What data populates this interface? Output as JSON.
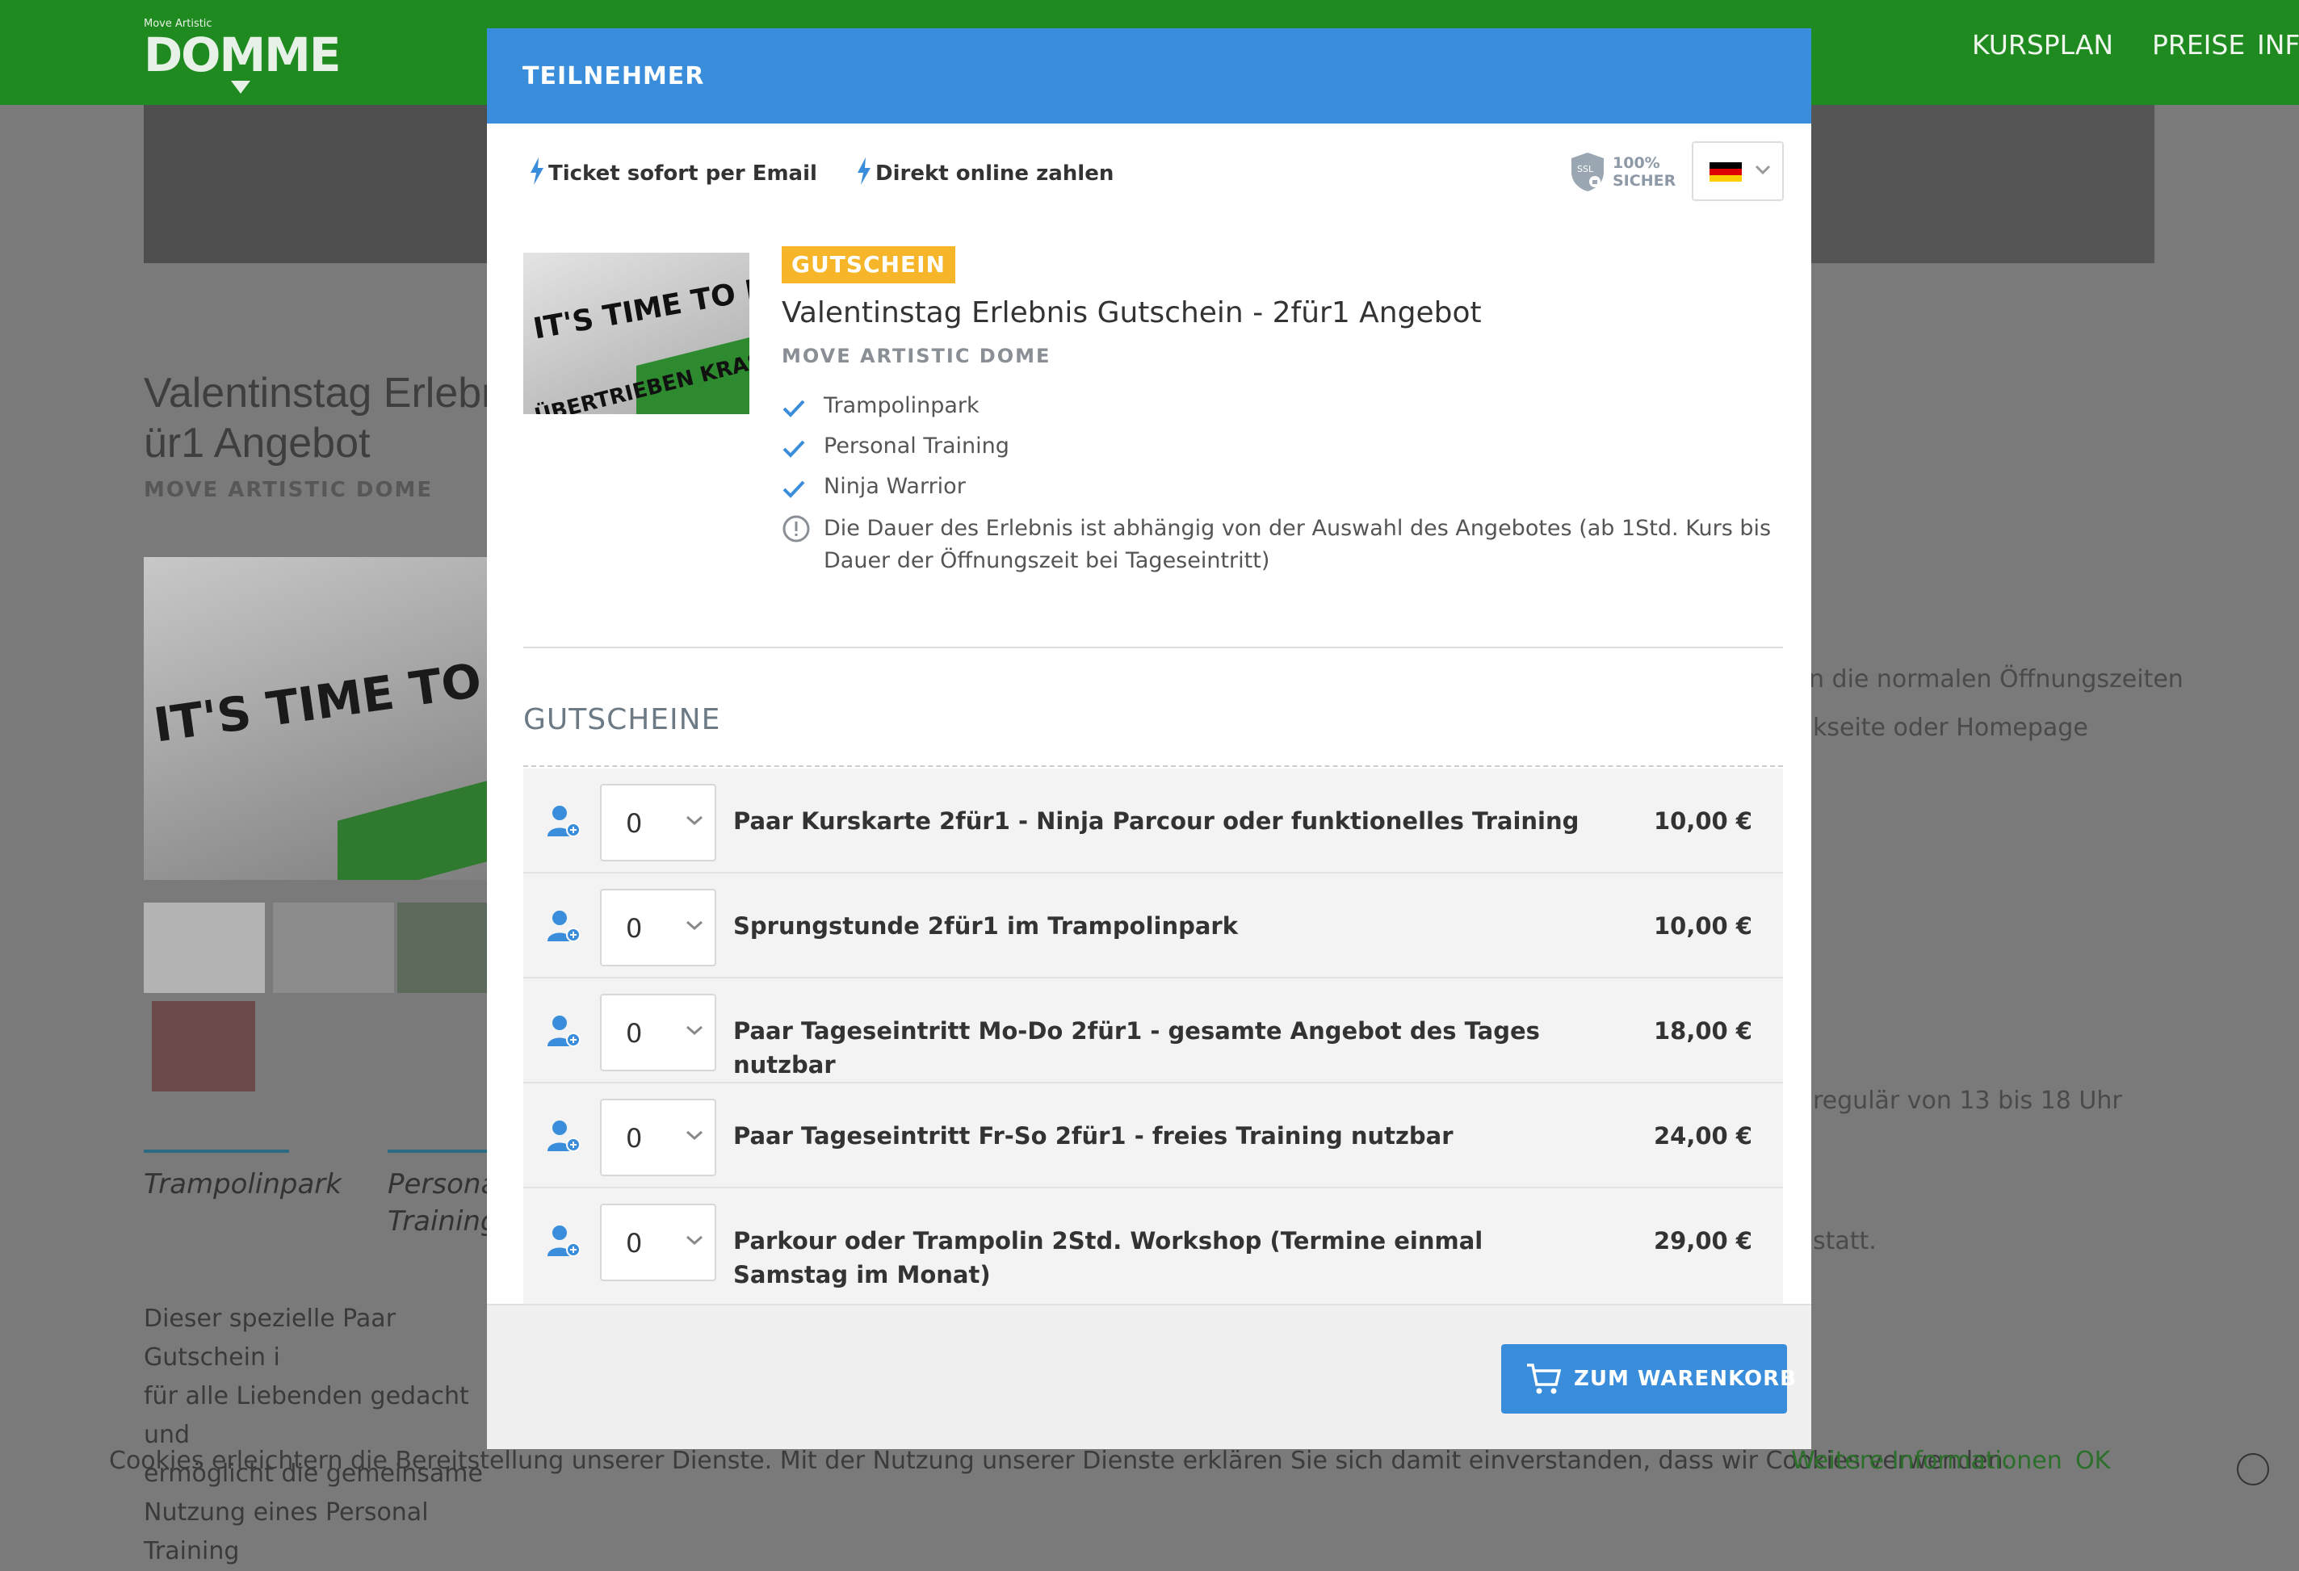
{
  "background": {
    "logo": {
      "small": "Move Artistic",
      "text": "DOMME"
    },
    "nav": [
      "KURSPLAN",
      "PREISE",
      "INFO"
    ],
    "title_lines": [
      "Valentinstag Erlebni",
      "ür1 Angebot"
    ],
    "subtitle": "MOVE ARTISTIC DOME",
    "tabs": [
      "Trampolinpark",
      "Persona",
      "Training"
    ],
    "paragraph": [
      "Dieser spezielle Paar Gutschein i",
      "für alle Liebenden gedacht und",
      "ermöglicht die gemeinsame",
      "Nutzung eines Personal Training"
    ],
    "right_text": [
      "n die normalen Öffnungszeiten",
      "kseite oder Homepage",
      "regulär von 13 bis 18 Uhr",
      "statt."
    ],
    "cookie": {
      "text": "Cookies erleichtern die Bereitstellung unserer Dienste. Mit der Nutzung unserer Dienste erklären Sie sich damit einverstanden, dass wir Cookies verwenden.",
      "more": "Weitere Informationen",
      "ok": "OK"
    }
  },
  "modal": {
    "title": "TEILNEHMER",
    "features": [
      "Ticket sofort per Email",
      "Direkt online zahlen"
    ],
    "ssl": {
      "line1": "100%",
      "line2": "SICHER",
      "badge": "SSL"
    },
    "language": "de",
    "product": {
      "badge": "GUTSCHEIN",
      "title": "Valentinstag Erlebnis Gutschein - 2für1 Angebot",
      "organizer": "MOVE ARTISTIC DOME",
      "image_text": [
        "IT'S TIME TO MOVE!",
        "ÜBERTRIEBEN KRASS!"
      ],
      "included": [
        "Trampolinpark",
        "Personal Training",
        "Ninja Warrior"
      ],
      "note": "Die Dauer des Erlebnis ist abhängig von der Auswahl des Angebotes (ab 1Std. Kurs bis Dauer der Öffnungszeit bei Tageseintritt)"
    },
    "section_title": "GUTSCHEINE",
    "tickets": [
      {
        "name": "Paar Kurskarte 2für1 - Ninja Parcour oder funktionelles Training",
        "price": "10,00 €",
        "qty": "0"
      },
      {
        "name": "Sprungstunde 2für1 im Trampolinpark",
        "price": "10,00 €",
        "qty": "0"
      },
      {
        "name": "Paar Tageseintritt Mo-Do 2für1 - gesamte Angebot des Tages nutzbar",
        "price": "18,00 €",
        "qty": "0"
      },
      {
        "name": "Paar Tageseintritt Fr-So 2für1 - freies Training nutzbar",
        "price": "24,00 €",
        "qty": "0"
      },
      {
        "name": "Parkour oder Trampolin 2Std. Workshop (Termine einmal Samstag im Monat)",
        "price": "29,00 €",
        "qty": "0"
      }
    ],
    "cart_button": "ZUM WARENKORB"
  },
  "colors": {
    "accent": "#3a8ddb",
    "badge": "#f7b52a",
    "header_green": "#1f8a1f"
  }
}
